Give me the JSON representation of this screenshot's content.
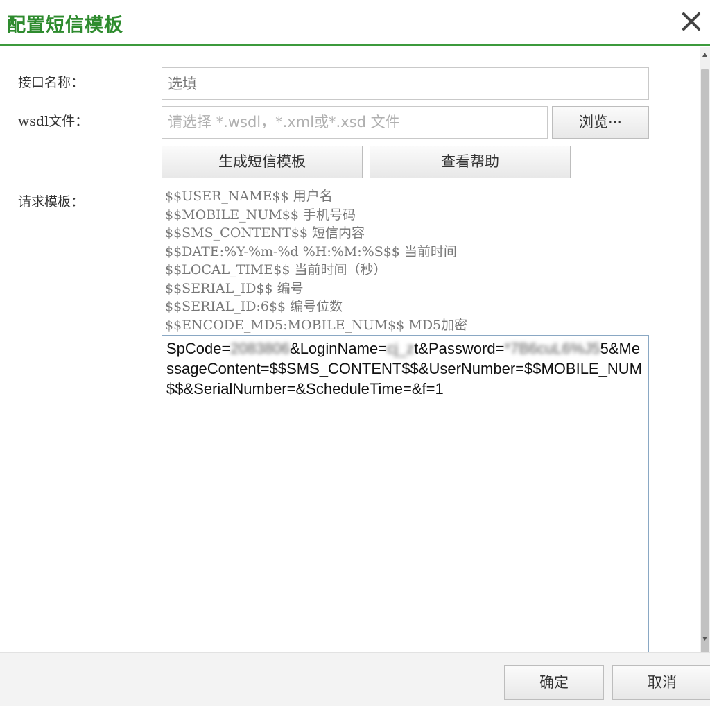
{
  "dialog": {
    "title": "配置短信模板"
  },
  "form": {
    "interface_name_label": "接口名称：",
    "interface_name_placeholder": "选填",
    "wsdl_label": "wsdl文件：",
    "wsdl_placeholder": "请选择 *.wsdl，*.xml或*.xsd 文件",
    "browse_label": "浏览···",
    "generate_label": "生成短信模板",
    "help_label": "查看帮助",
    "request_template_label": "请求模板："
  },
  "variables": [
    "$$USER_NAME$$ 用户名",
    "$$MOBILE_NUM$$ 手机号码",
    "$$SMS_CONTENT$$ 短信内容",
    "$$DATE:%Y-%m-%d %H:%M:%S$$ 当前时间",
    "$$LOCAL_TIME$$ 当前时间（秒）",
    "$$SERIAL_ID$$ 编号",
    "$$SERIAL_ID:6$$ 编号位数",
    "$$ENCODE_MD5:MOBILE_NUM$$ MD5加密"
  ],
  "template": {
    "part1": "SpCode=",
    "blur1": "2083806",
    "part2": "&LoginName=",
    "blur2": "cj_z",
    "part3": "t&Password=",
    "blur3": "*7B6cuL6%J5",
    "part4": "5&MessageContent=$$SMS_CONTENT$$&UserNumber=$$MOBILE_NUM$$&SerialNumber=&ScheduleTime=&f=1"
  },
  "footer": {
    "ok_label": "确定",
    "cancel_label": "取消"
  },
  "colors": {
    "title": "#2e8b2e",
    "accent_line": "#3c9a3c"
  },
  "icons": {
    "close": "close-icon"
  }
}
